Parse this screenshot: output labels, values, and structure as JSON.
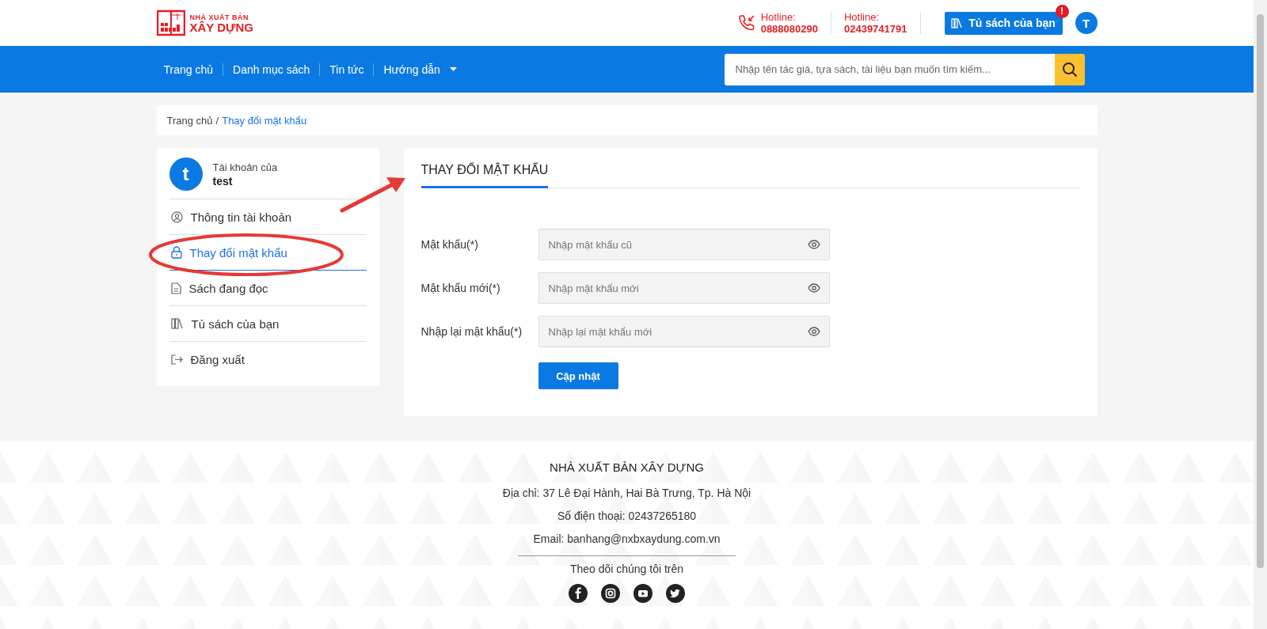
{
  "header": {
    "logo": {
      "line1": "NHÀ XUẤT BẢN",
      "line2": "XÂY DỰNG"
    },
    "hotlines": [
      {
        "label": "Hotline:",
        "number": "0888080290"
      },
      {
        "label": "Hotline:",
        "number": "02439741791"
      }
    ],
    "bookshelf_button": {
      "label": "Tủ sách của bạn",
      "badge": "!"
    },
    "avatar": "T"
  },
  "nav": {
    "items": [
      {
        "label": "Trang chủ",
        "has_menu": false
      },
      {
        "label": "Danh mục sách",
        "has_menu": false
      },
      {
        "label": "Tin tức",
        "has_menu": false
      },
      {
        "label": "Hướng dẫn",
        "has_menu": true
      }
    ],
    "search": {
      "placeholder": "Nhập tên tác giá, tựa sách, tài liệu bạn muốn tìm kiếm..."
    }
  },
  "breadcrumb": {
    "separator": "/",
    "items": [
      {
        "label": "Trang chủ",
        "current": false
      },
      {
        "label": "Thay đổi mật khẩu",
        "current": true
      }
    ]
  },
  "sidebar": {
    "avatar": "t",
    "account_label": "Tài khoản của",
    "username": "test",
    "items": [
      {
        "label": "Thông tin tài khoản",
        "selected": false
      },
      {
        "label": "Thay đổi mật khẩu",
        "selected": true
      },
      {
        "label": "Sách đang đọc",
        "selected": false
      },
      {
        "label": "Tủ sách của bạn",
        "selected": false
      },
      {
        "label": "Đăng xuất",
        "selected": false
      }
    ]
  },
  "main": {
    "title": "THAY ĐỔI MẬT KHẨU",
    "fields": [
      {
        "label": "Mật khẩu(*)",
        "placeholder": "Nhập mật khẩu cũ"
      },
      {
        "label": "Mật khẩu mới(*)",
        "placeholder": "Nhập mật khẩu mới"
      },
      {
        "label": "Nhập lại mật khẩu(*)",
        "placeholder": "Nhập lại mật khẩu mới"
      }
    ],
    "submit": "Cập nhật"
  },
  "footer": {
    "title": "NHÀ XUẤT BẢN XÂY DỰNG",
    "lines": [
      "Địa chỉ: 37 Lê Đại Hành, Hai Bà Trưng, Tp. Hà Nội",
      "Số điện thoại: 02437265180",
      "Email: banhang@nxbxaydung.com.vn"
    ],
    "follow": "Theo dõi chúng tôi trên"
  }
}
